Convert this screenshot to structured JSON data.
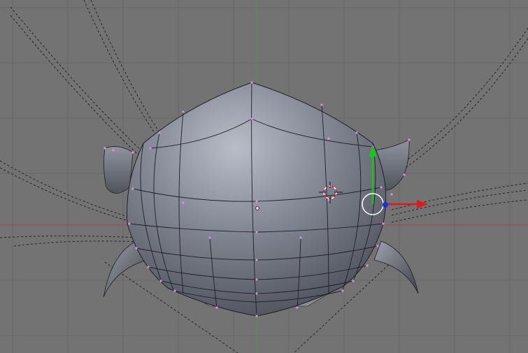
{
  "viewport": {
    "background": "#737373",
    "grid_color": "#676767",
    "x_axis_color": "#9a4a4a",
    "y_axis_color": "#4a9a4a"
  },
  "mesh": {
    "body_color": "#6f7480",
    "highlight_color": "#b9bdc8",
    "wire_color": "#1f1f26",
    "vertex_color": "#e18ee6"
  },
  "gizmo": {
    "x_color": "#e01818",
    "y_color": "#18c818",
    "z_color": "#1830e0",
    "center_ring_color": "#ffffff"
  },
  "cursor_3d": {
    "ring_colors": [
      "#ffffff",
      "#e02020"
    ]
  },
  "lattice": {
    "curve_color": "#222222"
  }
}
